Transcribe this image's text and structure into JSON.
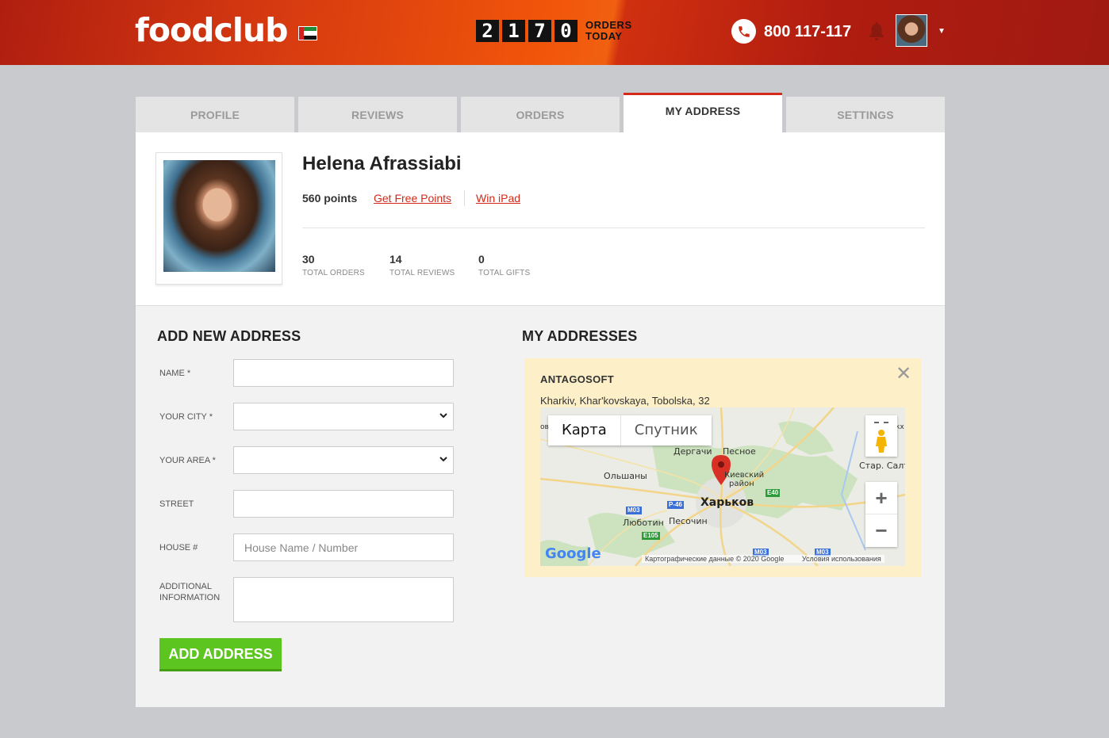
{
  "header": {
    "logo": "foodclub",
    "counter_digits": [
      "2",
      "1",
      "7",
      "0"
    ],
    "orders_label_line1": "ORDERS",
    "orders_label_line2": "TODAY",
    "phone": "800 117-117",
    "icons": [
      "uae-flag-icon",
      "phone-icon",
      "bell-icon",
      "chevron-down-icon"
    ]
  },
  "tabs": [
    {
      "label": "PROFILE"
    },
    {
      "label": "REVIEWS"
    },
    {
      "label": "ORDERS"
    },
    {
      "label": "MY ADDRESS",
      "active": true
    },
    {
      "label": "SETTINGS"
    }
  ],
  "profile": {
    "name": "Helena Afrassiabi",
    "points": "560 points",
    "link_free_points": "Get Free Points",
    "link_win": "Win iPad",
    "stats": [
      {
        "num": "30",
        "label": "TOTAL ORDERS"
      },
      {
        "num": "14",
        "label": "TOTAL REVIEWS"
      },
      {
        "num": "0",
        "label": "TOTAL GIFTS"
      }
    ]
  },
  "form": {
    "title": "ADD NEW ADDRESS",
    "name_label": "NAME *",
    "city_label": "YOUR CITY *",
    "area_label": "YOUR AREA *",
    "street_label": "STREET",
    "house_label": "HOUSE #",
    "house_placeholder": "House Name / Number",
    "additional_label_1": "ADDITIONAL",
    "additional_label_2": "INFORMATION",
    "submit_label": "ADD ADDRESS"
  },
  "addresses": {
    "title": "MY ADDRESSES",
    "items": [
      {
        "name": "ANTAGOSOFT",
        "address": "Kharkiv, Khar'kovskaya, Tobolska, 32",
        "close": "✕"
      }
    ]
  },
  "map": {
    "type_map": "Карта",
    "type_satellite": "Спутник",
    "zoom_in": "+",
    "zoom_out": "−",
    "google": "Google",
    "attribution": "Картографические данные © 2020 Google",
    "terms": "Условия использования",
    "city": "Харьков",
    "labels": [
      "Дергачи",
      "Песное",
      "Ольшаны",
      "Киевский",
      "район",
      "Люботин",
      "Песочин",
      "Стар. Салт",
      "ов",
      "кх"
    ],
    "roads": [
      "M03",
      "P-46",
      "E105",
      "E40",
      "M03",
      "M03"
    ],
    "colors": {
      "marker": "#d93025",
      "water": "#a8c8f0",
      "green": "#cde3bf"
    }
  },
  "colors": {
    "accent": "#d32a1a",
    "button": "#5cc51f",
    "address_card": "#fdefc8"
  }
}
